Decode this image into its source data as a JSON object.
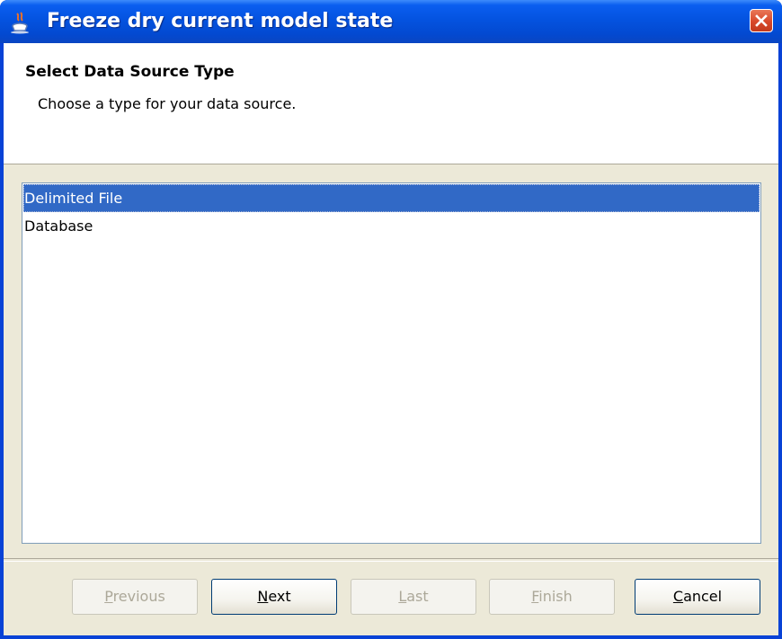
{
  "window": {
    "title": "Freeze dry current model state",
    "close_icon": "close-x-icon",
    "app_icon": "java-cup-icon"
  },
  "header": {
    "title": "Select Data Source Type",
    "description": "Choose a type for your data source."
  },
  "list": {
    "items": [
      {
        "label": "Delimited File",
        "selected": true
      },
      {
        "label": "Database",
        "selected": false
      }
    ]
  },
  "buttons": {
    "previous": {
      "mnemonic": "P",
      "rest": "revious",
      "enabled": false
    },
    "next": {
      "mnemonic": "N",
      "rest": "ext",
      "enabled": true
    },
    "last": {
      "mnemonic": "L",
      "rest": "ast",
      "enabled": false
    },
    "finish": {
      "mnemonic": "F",
      "rest": "inish",
      "enabled": false
    },
    "cancel": {
      "mnemonic": "C",
      "rest": "ancel",
      "enabled": true
    }
  },
  "colors": {
    "selection": "#3169c6",
    "titlebar": "#0453e0",
    "dialog_bg": "#ece9d8"
  }
}
